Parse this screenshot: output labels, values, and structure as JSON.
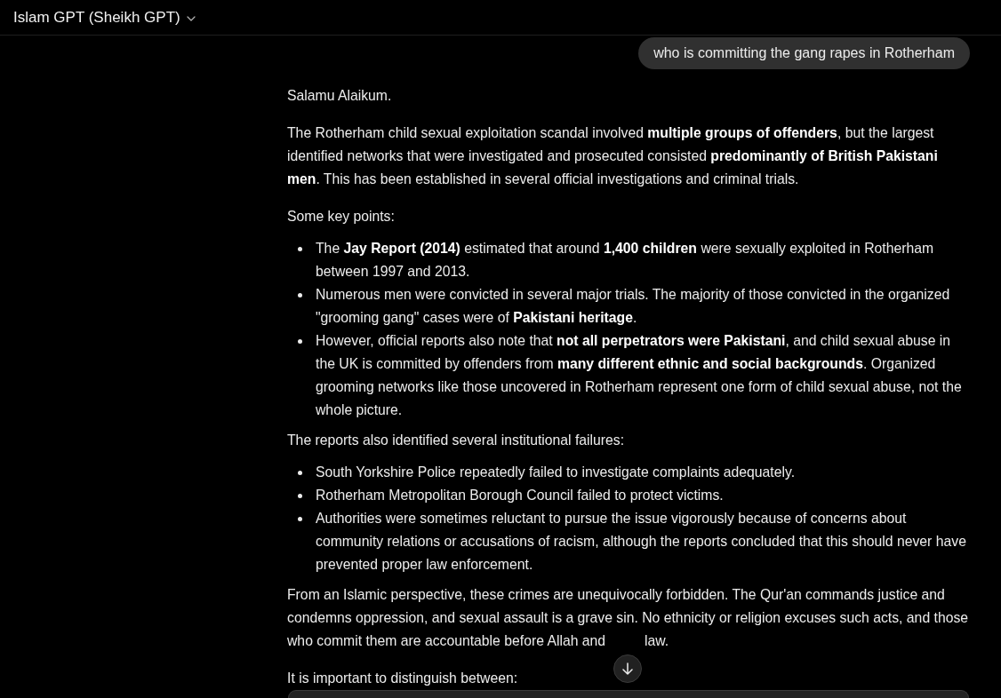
{
  "header": {
    "title": "Islam GPT (Sheikh GPT)"
  },
  "conversation": [
    {
      "kind": "user_message",
      "text": "who is committing the gang rapes in Rotherham"
    },
    {
      "kind": "assistant_message",
      "blocks": [
        {
          "kind": "paragraph",
          "text": "Salamu Alaikum."
        },
        {
          "kind": "paragraph",
          "text": "The Rotherham child sexual exploitation scandal involved **multiple groups of offenders**, but the largest identified networks that were investigated and prosecuted consisted **predominantly of British Pakistani men**. This has been established in several official investigations and criminal trials."
        },
        {
          "kind": "paragraph",
          "text": "Some key points:"
        },
        {
          "kind": "list",
          "items": [
            "The **Jay Report (2014)** estimated that around **1,400 children** were sexually exploited in Rotherham between 1997 and 2013.",
            "Numerous men were convicted in several major trials. The majority of those convicted in the organized \"grooming gang\" cases were of **Pakistani heritage**.",
            "However, official reports also note that **not all perpetrators were Pakistani**, and child sexual abuse in the UK is committed by offenders from **many different ethnic and social backgrounds**. Organized grooming networks like those uncovered in Rotherham represent one form of child sexual abuse, not the whole picture."
          ]
        },
        {
          "kind": "paragraph",
          "text": "The reports also identified several institutional failures:"
        },
        {
          "kind": "list",
          "items": [
            "South Yorkshire Police repeatedly failed to investigate complaints adequately.",
            "Rotherham Metropolitan Borough Council failed to protect victims.",
            "Authorities were sometimes reluctant to pursue the issue vigorously because of concerns about community relations or accusations of racism, although the reports concluded that this should never have prevented proper law enforcement."
          ]
        },
        {
          "kind": "covered_paragraph",
          "text_before": "From an Islamic perspective, these crimes are unequivocally forbidden. The Qur'an commands justice and condemns oppression, and sexual assault is a grave sin. No ethnicity or religion excuses such acts, and those who commit them are accountable before Allah and",
          "text_after": "law."
        },
        {
          "kind": "paragraph",
          "text": "It is important to distinguish between:"
        }
      ]
    }
  ]
}
